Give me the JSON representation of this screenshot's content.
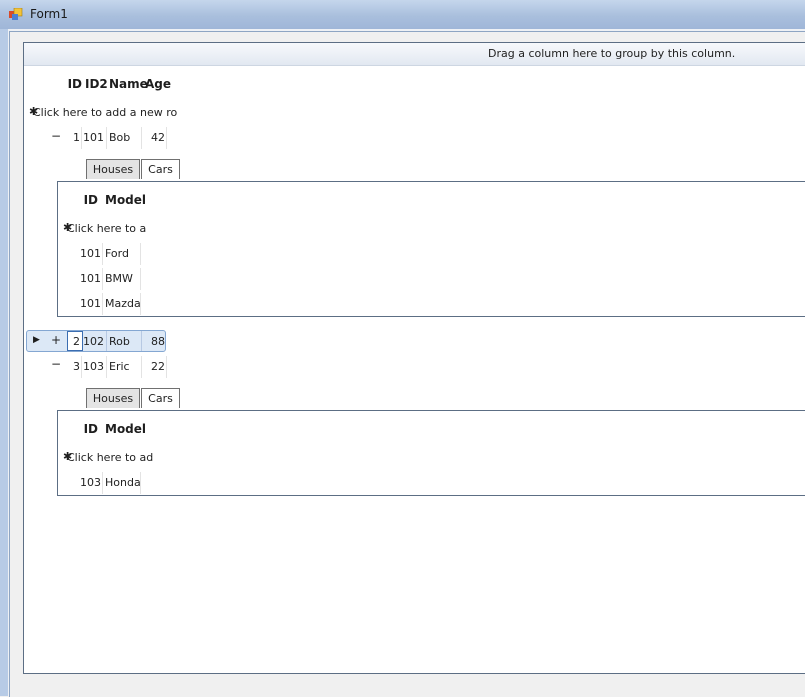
{
  "window": {
    "title": "Form1"
  },
  "grid": {
    "group_panel_text": "Drag a column here to group by this column.",
    "columns": [
      "ID",
      "ID2",
      "Name",
      "Age"
    ],
    "new_row_text": "Click here to add a new ro",
    "rows": [
      {
        "id": "1",
        "id2": "101",
        "name": "Bob",
        "age": "42",
        "expander": "−"
      },
      {
        "id": "2",
        "id2": "102",
        "name": "Rob",
        "age": "88",
        "expander": "+",
        "indicator": "▶"
      },
      {
        "id": "3",
        "id2": "103",
        "name": "Eric",
        "age": "22",
        "expander": "−"
      }
    ],
    "child_tabs": [
      "Houses",
      "Cars"
    ],
    "child_columns": [
      "ID",
      "Model"
    ],
    "child1": {
      "new_row_text": "Click here to a",
      "rows": [
        {
          "id": "101",
          "model": "Ford"
        },
        {
          "id": "101",
          "model": "BMW"
        },
        {
          "id": "101",
          "model": "Mazda"
        }
      ]
    },
    "child3": {
      "new_row_text": "Click here to ad",
      "rows": [
        {
          "id": "103",
          "model": "Honda"
        }
      ]
    }
  }
}
